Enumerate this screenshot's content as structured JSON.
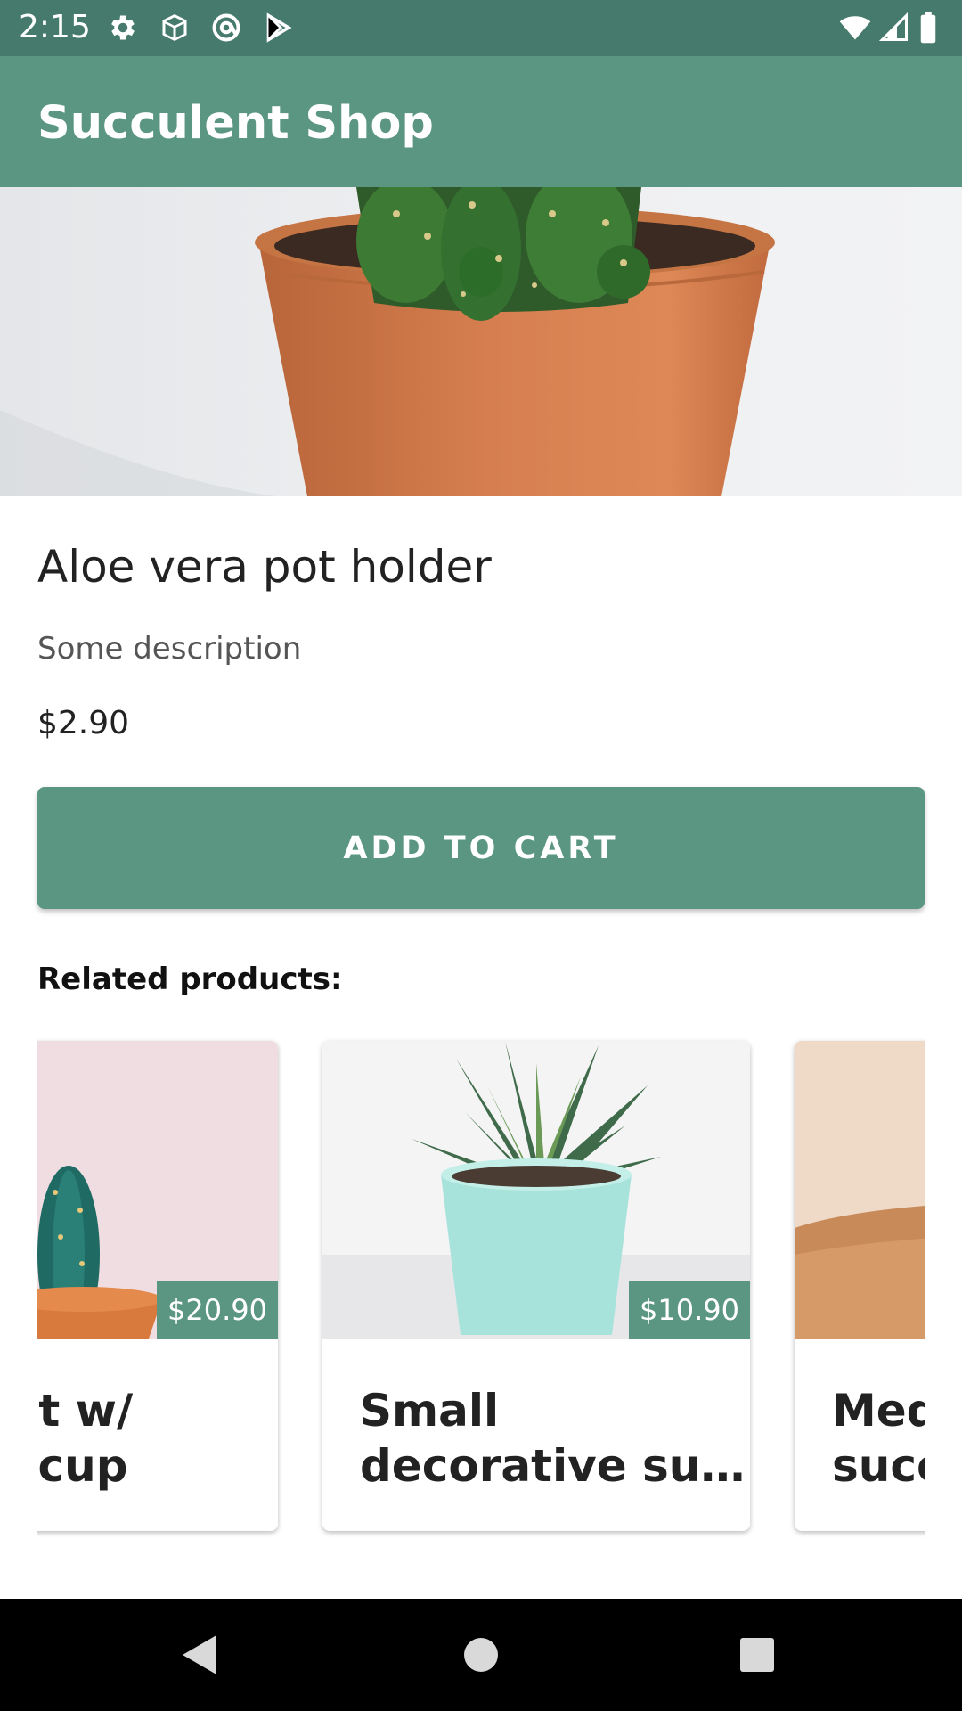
{
  "status_bar": {
    "time": "2:15",
    "icons": [
      "settings-gear-icon",
      "package-icon",
      "at-sign-icon",
      "play-store-icon",
      "wifi-icon",
      "cell-signal-icon",
      "battery-icon"
    ]
  },
  "app_bar": {
    "title": "Succulent Shop",
    "color": "#5a9682"
  },
  "product": {
    "name": "Aloe vera pot holder",
    "description": "Some description",
    "price": "$2.90",
    "add_to_cart_label": "ADD TO CART"
  },
  "related": {
    "title": "Related products:",
    "items": [
      {
        "title": "s plant w/\ns in a cup",
        "price": "$20.90"
      },
      {
        "title": "Small\ndecorative su…",
        "price": "$10.90"
      },
      {
        "title": "Med\nsucc",
        "price": ""
      }
    ]
  },
  "nav_bar": {
    "icons": [
      "back-icon",
      "home-icon",
      "recents-icon"
    ]
  }
}
